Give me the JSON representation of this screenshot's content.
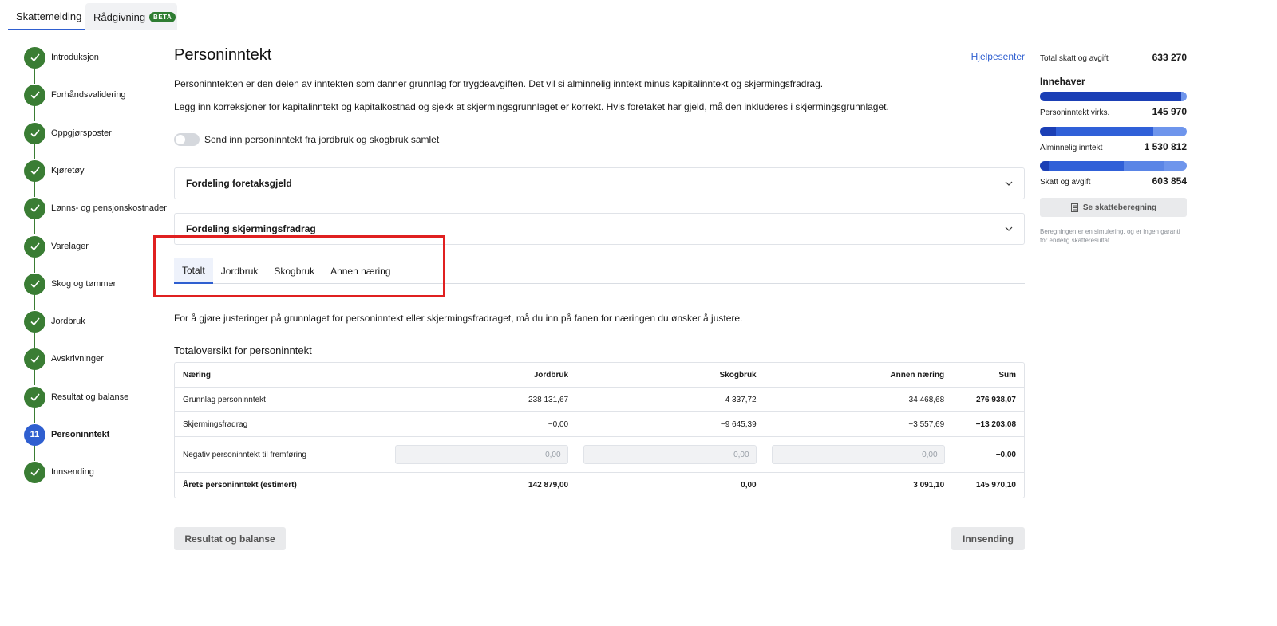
{
  "top_tabs": [
    {
      "label": "Skattemelding",
      "active": true
    },
    {
      "label": "Rådgivning",
      "badge": "BETA",
      "active": false
    }
  ],
  "steps": [
    {
      "label": "Introduksjon",
      "status": "done"
    },
    {
      "label": "Forhåndsvalidering",
      "status": "done"
    },
    {
      "label": "Oppgjørsposter",
      "status": "done"
    },
    {
      "label": "Kjøretøy",
      "status": "done"
    },
    {
      "label": "Lønns- og pensjonskostnader",
      "status": "done"
    },
    {
      "label": "Varelager",
      "status": "done"
    },
    {
      "label": "Skog og tømmer",
      "status": "done"
    },
    {
      "label": "Jordbruk",
      "status": "done"
    },
    {
      "label": "Avskrivninger",
      "status": "done"
    },
    {
      "label": "Resultat og balanse",
      "status": "done"
    },
    {
      "label": "Personinntekt",
      "number": "11",
      "status": "active"
    },
    {
      "label": "Innsending",
      "status": "done"
    }
  ],
  "main": {
    "title": "Personinntekt",
    "help_link": "Hjelpesenter",
    "intro1": "Personinntekten er den delen av inntekten som danner grunnlag for trygdeavgiften. Det vil si alminnelig inntekt minus kapitalinntekt og skjermingsfradrag.",
    "intro2": "Legg inn korreksjoner for kapitalinntekt og kapitalkostnad og sjekk at skjermingsgrunnlaget er korrekt. Hvis foretaket har gjeld, må den inkluderes i skjermingsgrunnlaget.",
    "toggle_label": "Send inn personinntekt fra jordbruk og skogbruk samlet",
    "accordion1": "Fordeling foretaksgjeld",
    "accordion2": "Fordeling skjermingsfradrag",
    "tabs": [
      "Totalt",
      "Jordbruk",
      "Skogbruk",
      "Annen næring"
    ],
    "active_tab": "Totalt",
    "tab_hint": "For å gjøre justeringer på grunnlaget for personinntekt eller skjermingsfradraget, må du inn på fanen for næringen du ønsker å justere.",
    "section_title": "Totaloversikt for personinntekt",
    "table": {
      "headers": [
        "Næring",
        "Jordbruk",
        "Skogbruk",
        "Annen næring",
        "Sum"
      ],
      "rows": [
        [
          "Grunnlag personinntekt",
          "238 131,67",
          "4 337,72",
          "34 468,68",
          "276 938,07"
        ],
        [
          "Skjermingsfradrag",
          "−0,00",
          "−9 645,39",
          "−3 557,69",
          "−13 203,08"
        ],
        [
          "Negativ personinntekt til fremføring",
          "0,00",
          "0,00",
          "0,00",
          "−0,00"
        ],
        [
          "Årets personinntekt (estimert)",
          "142 879,00",
          "0,00",
          "3 091,10",
          "145 970,10"
        ]
      ]
    },
    "prev_button": "Resultat og balanse",
    "next_button": "Innsending"
  },
  "side": {
    "total_label": "Total skatt og avgift",
    "total_value": "633 270",
    "heading": "Innehaver",
    "items": [
      {
        "label": "Personinntekt virks.",
        "value": "145 970"
      },
      {
        "label": "Alminnelig inntekt",
        "value": "1 530 812"
      },
      {
        "label": "Skatt og avgift",
        "value": "603 854"
      }
    ],
    "button": "Se skatteberegning",
    "note": "Beregningen er en simulering, og er ingen garanti for endelig skatteresultat.",
    "colors": {
      "dark": "#1b3fb5",
      "mid": "#3060d8",
      "light": "#6e95ec"
    }
  }
}
